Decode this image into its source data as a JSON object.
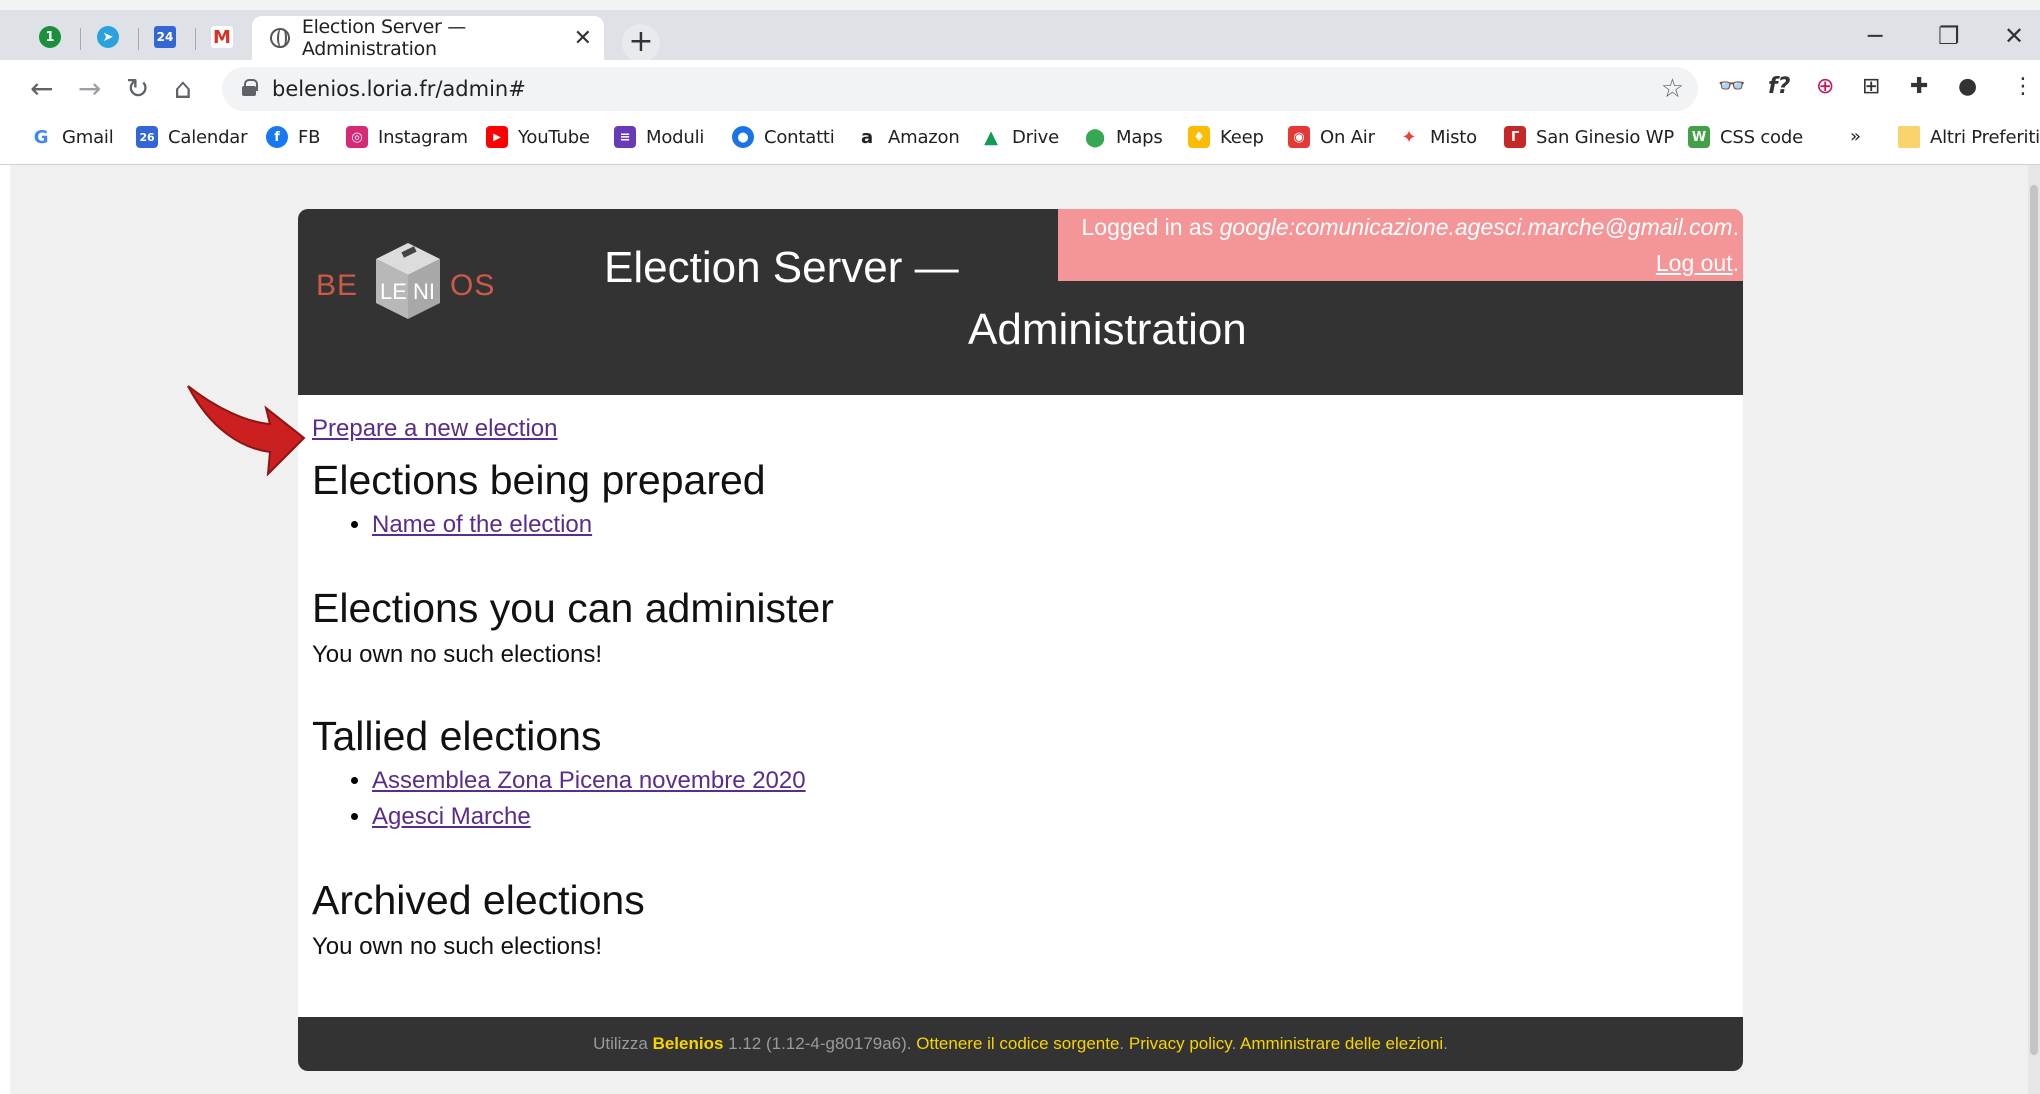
{
  "browser": {
    "pinned_tabs": [
      {
        "name": "1password-icon",
        "label": "1"
      },
      {
        "name": "telegram-icon",
        "label": ""
      },
      {
        "name": "calendar-tab-icon",
        "label": "24"
      },
      {
        "name": "gmail-tab-icon",
        "label": "M"
      }
    ],
    "tab_title": "Election Server — Administration",
    "url": "belenios.loria.fr/admin#",
    "bookmarks": [
      {
        "label": "Gmail",
        "icon": "google-icon",
        "color": "#4285f4",
        "glyph": "G"
      },
      {
        "label": "Calendar",
        "icon": "calendar-icon",
        "color": "#3367d6",
        "glyph": "26"
      },
      {
        "label": "FB",
        "icon": "facebook-icon",
        "color": "#1877f2",
        "glyph": "f"
      },
      {
        "label": "Instagram",
        "icon": "instagram-icon",
        "color": "#d62976",
        "glyph": "◎"
      },
      {
        "label": "YouTube",
        "icon": "youtube-icon",
        "color": "#ff0000",
        "glyph": "▶"
      },
      {
        "label": "Moduli",
        "icon": "forms-icon",
        "color": "#673ab7",
        "glyph": "≡"
      },
      {
        "label": "Contatti",
        "icon": "contacts-icon",
        "color": "#1a73e8",
        "glyph": "●"
      },
      {
        "label": "Amazon",
        "icon": "amazon-icon",
        "color": "#222222",
        "glyph": "a"
      },
      {
        "label": "Drive",
        "icon": "drive-icon",
        "color": "#0f9d58",
        "glyph": "▲"
      },
      {
        "label": "Maps",
        "icon": "maps-icon",
        "color": "#34a853",
        "glyph": "⬤"
      },
      {
        "label": "Keep",
        "icon": "keep-icon",
        "color": "#fbbc04",
        "glyph": "♦"
      },
      {
        "label": "On Air",
        "icon": "onair-icon",
        "color": "#e53935",
        "glyph": "◉"
      },
      {
        "label": "Misto",
        "icon": "pinwheel-icon",
        "color": "#ea4335",
        "glyph": "✦"
      },
      {
        "label": "San Ginesio WP",
        "icon": "sanginesio-icon",
        "color": "#c62828",
        "glyph": "Г"
      },
      {
        "label": "CSS code",
        "icon": "w3c-icon",
        "color": "#43a047",
        "glyph": "W"
      }
    ],
    "bookmarks_overflow": "»",
    "other_bookmarks": "Altri Preferiti"
  },
  "header": {
    "logo_text_left": "BE",
    "logo_text_cube": "LE NI",
    "logo_text_right": "OS",
    "title_line1": "Election Server —",
    "title_line2": "Administration",
    "login_prefix": "Logged in as ",
    "login_user": "google:comunicazione.agesci.marche@gmail.com",
    "login_period": ".",
    "logout_label": "Log out",
    "logout_period": "."
  },
  "main": {
    "prepare_link": "Prepare a new election",
    "sections": {
      "prepared": {
        "title": "Elections being prepared",
        "items": [
          "Name of the election"
        ]
      },
      "administer": {
        "title": "Elections you can administer",
        "empty": "You own no such elections!"
      },
      "tallied": {
        "title": "Tallied elections",
        "items": [
          "Assemblea Zona Picena novembre 2020",
          "Agesci Marche"
        ]
      },
      "archived": {
        "title": "Archived elections",
        "empty": "You own no such elections!"
      }
    }
  },
  "footer": {
    "prefix": "Utilizza ",
    "product": "Belenios",
    "version": " 1.12 (1.12-4-g80179a6). ",
    "source_link": "Ottenere il codice sorgente",
    "sep1": ". ",
    "privacy_link": "Privacy policy",
    "sep2": ". ",
    "admin_link": "Amministrare delle elezioni",
    "end": "."
  },
  "colors": {
    "header_bg": "#333333",
    "login_bg": "#f49597",
    "link": "#5a2d8a",
    "footer_link": "#f7d400",
    "annotation_arrow": "#cc1f1f"
  }
}
